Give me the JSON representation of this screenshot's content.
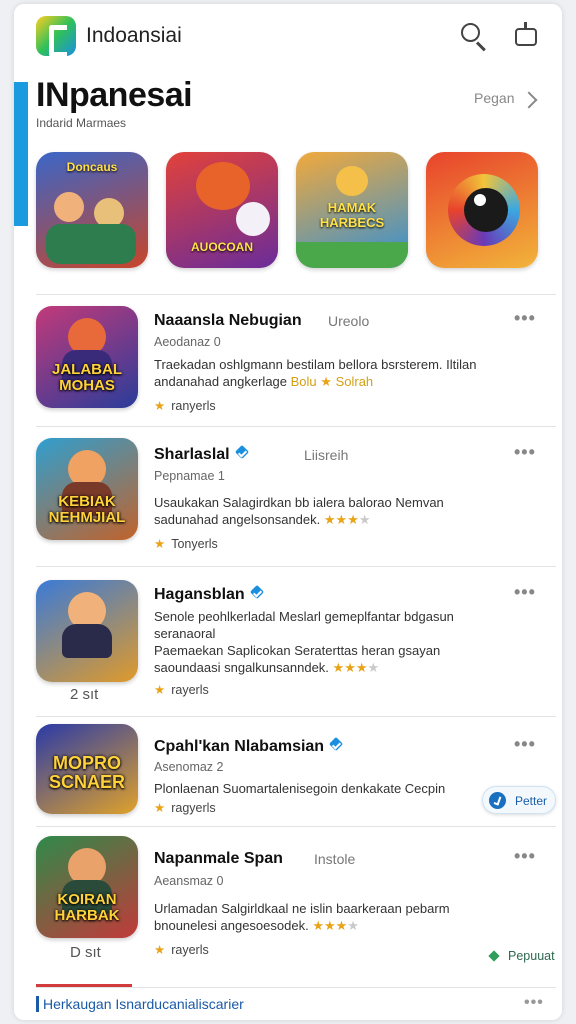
{
  "app": {
    "name": "Indoansiai",
    "icons": {
      "logo": "app-logo-icon",
      "search": "search-icon",
      "cast": "cast-icon"
    },
    "accent": "#1a9be0"
  },
  "header": {
    "title": "INpanesai",
    "subtitle": "Indarid Marmaes",
    "link": "Pegan"
  },
  "featured": [
    {
      "label": "Doncaus",
      "colors": [
        "#3a66c8",
        "#c8452a"
      ]
    },
    {
      "label": "AUOCOAN",
      "colors": [
        "#e2423a",
        "#6a2c9a"
      ]
    },
    {
      "label": "HAMAK HARBECS",
      "colors": [
        "#f2a93b",
        "#2f8fd8"
      ]
    },
    {
      "label": "",
      "colors": [
        "#e8432c",
        "#f2b43a"
      ]
    }
  ],
  "list": [
    {
      "title": "Naaansla Nebugian",
      "tag": "Ureolo",
      "verified": false,
      "meta": "Aeodanaz 0",
      "desc1": "Traekadan oshlgmann bestilam bellora bsrsterem. Iltilan",
      "desc2": "andanahad angkerlage",
      "desc_accent": "Bolu",
      "desc_star": "★",
      "desc_tail": "Solrah",
      "stars_full": "",
      "stars_dim": "",
      "rating": "ranyerls",
      "under_icon": "",
      "icon_label": "JALABAL MOHAS",
      "icon_colors": [
        "#c23a7a",
        "#2a3c9a"
      ]
    },
    {
      "title": "Sharlaslal",
      "tag": "Liisreih",
      "verified": true,
      "meta": "Pepnamae 1",
      "desc1": "Usaukakan Salagirdkan bb ialera balorao Nemvan",
      "desc2": "sadunahad angelsonsandek.",
      "desc_accent": "",
      "desc_star": "",
      "desc_tail": "",
      "stars_full": "★★★",
      "stars_dim": "★",
      "rating": "Tonyerls",
      "under_icon": "",
      "icon_label": "KEBIAK NEHMJIAL",
      "icon_colors": [
        "#2f9fd0",
        "#c2622a"
      ]
    },
    {
      "title": "Hagansblan",
      "tag": "",
      "verified": true,
      "meta": "",
      "desc1": "Senole peohlkerladal Meslarl gemeplfantar bdgasun",
      "desc1b": "seranaoral",
      "desc2": "Paemaekan Saplicokan Seraterttas heran gsayan",
      "desc3": "saoundaasi sngalkunsanndek.",
      "desc_accent": "",
      "desc_star": "",
      "desc_tail": "",
      "stars_full": "★★★",
      "stars_dim": "★",
      "rating": "rayerls",
      "under_icon": "2 sıt",
      "icon_label": "",
      "icon_colors": [
        "#3a7ad8",
        "#e09a2a"
      ]
    },
    {
      "title": "Cpahl'kan Nlabamsian",
      "tag": "",
      "verified": true,
      "meta": "Asenomaz 2",
      "desc1": "Plonlaenan Suomartalenisegoin denkakate Cecpin",
      "desc2": "",
      "desc_accent": "",
      "desc_star": "",
      "desc_tail": "",
      "stars_full": "",
      "stars_dim": "",
      "rating": "ragyerls",
      "under_icon": "",
      "icon_label": "MOPRO SCNAER",
      "icon_colors": [
        "#2a3aa8",
        "#e0a22a"
      ]
    },
    {
      "title": "Napanmale Span",
      "tag": "Instole",
      "verified": false,
      "meta": "Aeansmaz 0",
      "desc1": "Urlamadan Salgirldkaal ne islin baarkeraan pebarm",
      "desc2": "bnounelesi angesoesodek.",
      "desc_accent": "",
      "desc_star": "",
      "desc_tail": "",
      "stars_full": "★★★",
      "stars_dim": "★",
      "rating": "rayerls",
      "under_icon": "D sıt",
      "icon_label": "KOIRAN HARBAK",
      "icon_colors": [
        "#2f8a4a",
        "#c23a3a"
      ]
    }
  ],
  "pill": {
    "label": "Petter",
    "icon": "check-circle-icon"
  },
  "repair": {
    "label": "Pepuuat",
    "icon": "diamond-icon"
  },
  "bottom": {
    "label": "Herkaugan Isnarducanialiscarier"
  }
}
